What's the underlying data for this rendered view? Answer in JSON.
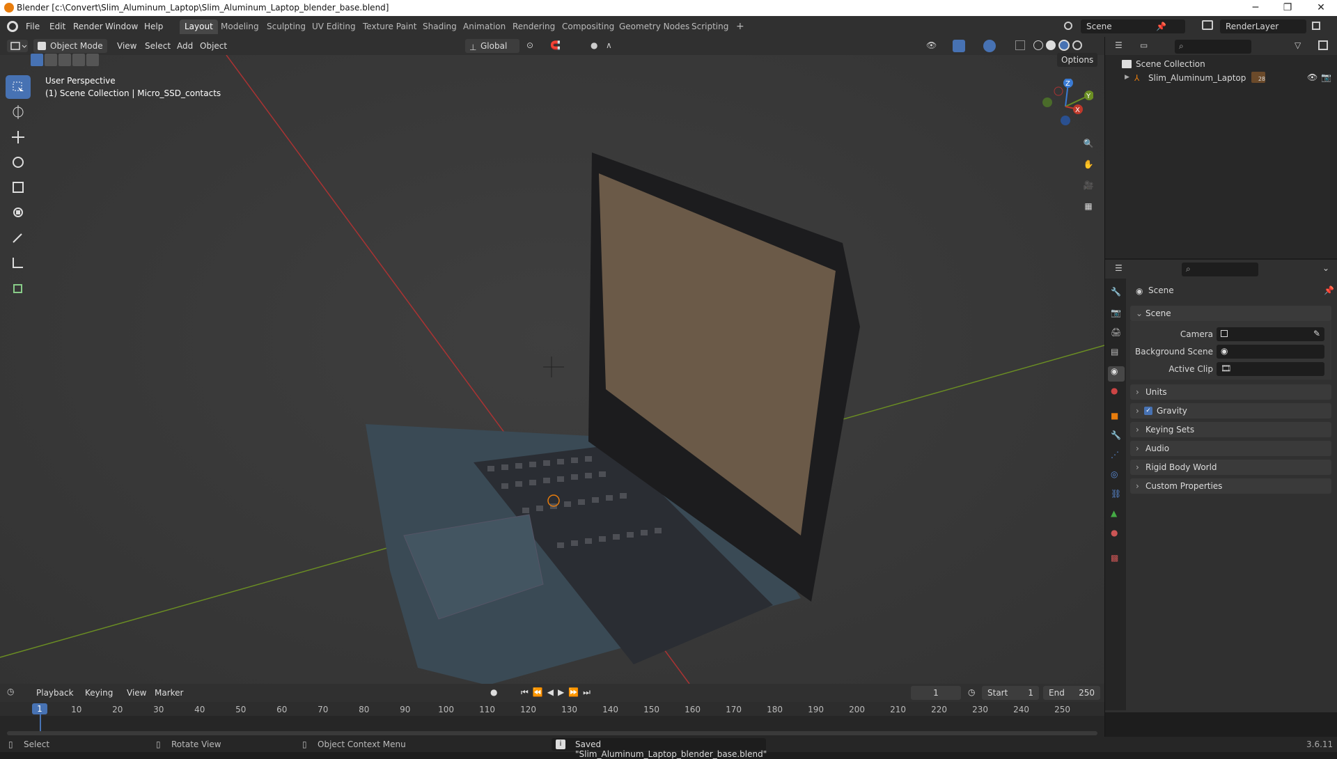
{
  "window": {
    "title": "Blender [c:\\Convert\\Slim_Aluminum_Laptop\\Slim_Aluminum_Laptop_blender_base.blend]",
    "minimize": "─",
    "maximize": "❐",
    "close": "✕"
  },
  "menu": {
    "items": [
      "File",
      "Edit",
      "Render",
      "Window",
      "Help"
    ],
    "workspaces": [
      "Layout",
      "Modeling",
      "Sculpting",
      "UV Editing",
      "Texture Paint",
      "Shading",
      "Animation",
      "Rendering",
      "Compositing",
      "Geometry Nodes",
      "Scripting"
    ],
    "add_tab": "+",
    "scene_name": "Scene",
    "view_layer": "RenderLayer"
  },
  "viewport_header": {
    "mode": "Object Mode",
    "menus": [
      "View",
      "Select",
      "Add",
      "Object"
    ],
    "transform_orientation": "Global",
    "options": "Options"
  },
  "viewport": {
    "perspective": "User Perspective",
    "collection_info": "(1) Scene Collection | Micro_SSD_contacts",
    "gizmo": {
      "z": "Z",
      "y": "Y",
      "x": "X"
    }
  },
  "outliner": {
    "root": "Scene Collection",
    "items": [
      {
        "name": "Slim_Aluminum_Laptop",
        "badge": "28"
      }
    ]
  },
  "properties": {
    "context": "Scene",
    "sections": {
      "scene": "Scene",
      "camera_label": "Camera",
      "background_label": "Background Scene",
      "clip_label": "Active Clip"
    },
    "panels": [
      "Units",
      "Gravity",
      "Keying Sets",
      "Audio",
      "Rigid Body World",
      "Custom Properties"
    ]
  },
  "timeline": {
    "menus": [
      "Playback",
      "Keying",
      "View",
      "Marker"
    ],
    "current_frame": "1",
    "start_label": "Start",
    "start": "1",
    "end_label": "End",
    "end": "250",
    "ticks": [
      "1",
      "10",
      "20",
      "30",
      "40",
      "50",
      "60",
      "70",
      "80",
      "90",
      "100",
      "110",
      "120",
      "130",
      "140",
      "150",
      "160",
      "170",
      "180",
      "190",
      "200",
      "210",
      "220",
      "230",
      "240",
      "250"
    ]
  },
  "status": {
    "select": "Select",
    "rotate": "Rotate View",
    "context_menu": "Object Context Menu",
    "message": "Saved \"Slim_Aluminum_Laptop_blender_base.blend\"",
    "version": "3.6.11"
  },
  "colors": {
    "accent": "#4772b3",
    "x_axis": "#c0392b",
    "y_axis": "#6b8e23",
    "z_axis": "#3a7bd5"
  }
}
